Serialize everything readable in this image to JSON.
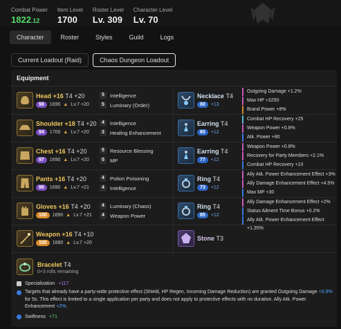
{
  "header": {
    "combat_power_label": "Combat Power",
    "combat_power_value": "1822",
    "combat_power_decimal": ".12",
    "item_level_label": "Item Level",
    "item_level_value": "1700",
    "roster_level_label": "Roster Level",
    "roster_level_value": "Lv. 309",
    "character_level_label": "Character Level",
    "character_level_value": "Lv. 70"
  },
  "tabs": [
    "Character",
    "Roster",
    "Styles",
    "Guild",
    "Logs"
  ],
  "loadouts": [
    "Current Loadout (Raid)",
    "Chaos Dungeon Loadout"
  ],
  "equipment": {
    "title": "Equipment",
    "left": [
      {
        "name": "Head +16",
        "tier": "T4 +20",
        "quality": "98",
        "ilvl": "1690",
        "transcend": "Lv.7 +20",
        "engravings": [
          {
            "n": "5",
            "label": "Intelligence"
          },
          {
            "n": "5",
            "label": "Luminary (Order)"
          }
        ]
      },
      {
        "name": "Shoulder +18",
        "tier": "T4 +20",
        "quality": "94",
        "ilvl": "1700",
        "transcend": "Lv.7 +20",
        "engravings": [
          {
            "n": "4",
            "label": "Intelligence"
          },
          {
            "n": "3",
            "label": "Healing Enhancement"
          }
        ]
      },
      {
        "name": "Chest +16",
        "tier": "T4 +20",
        "quality": "97",
        "ilvl": "1690",
        "transcend": "Lv.7 +20",
        "engravings": [
          {
            "n": "5",
            "label": "Resource Blessing"
          },
          {
            "n": "5",
            "label": "MP"
          }
        ]
      },
      {
        "name": "Pants +16",
        "tier": "T4 +20",
        "quality": "96",
        "ilvl": "1690",
        "transcend": "Lv.7 +21",
        "engravings": [
          {
            "n": "4",
            "label": "Potion Poisoning"
          },
          {
            "n": "4",
            "label": "Intelligence"
          }
        ]
      },
      {
        "name": "Gloves +16",
        "tier": "T4 +20",
        "quality": "100",
        "ilvl": "1690",
        "transcend": "Lv.7 +21",
        "engravings": [
          {
            "n": "4",
            "label": "Luminary (Chaos)"
          },
          {
            "n": "4",
            "label": "Weapon Power"
          }
        ]
      },
      {
        "name": "Weapon +16",
        "tier": "T4 +10",
        "quality": "100",
        "ilvl": "1680",
        "transcend": "Lv.7 +20",
        "engravings": []
      }
    ],
    "right": [
      {
        "name": "Necklace",
        "tier": "T4",
        "quality": "80",
        "bonus": "+13",
        "effects": [
          "Outgoing Damage +1.2%",
          "Max HP +3250",
          "Brand Power +8%"
        ]
      },
      {
        "name": "Earring",
        "tier": "T4",
        "quality": "80",
        "bonus": "+12",
        "effects": [
          "Combat HP Recovery +25",
          "Weapon Power +0.8%",
          "Atk. Power +80"
        ]
      },
      {
        "name": "Earring",
        "tier": "T4",
        "quality": "77",
        "bonus": "+12",
        "effects": [
          "Weapon Power +0.8%",
          "Recovery for Party Members +2.1%",
          "Combat HP Recovery +10"
        ]
      },
      {
        "name": "Ring",
        "tier": "T4",
        "quality": "73",
        "bonus": "+12",
        "effects": [
          "Ally Atk. Power Enhancement Effect +3%",
          "Ally Damage Enhancement Effect +4.5%",
          "Max MP +30"
        ]
      },
      {
        "name": "Ring",
        "tier": "T4",
        "quality": "85",
        "bonus": "+12",
        "effects": [
          "Ally Damage Enhancement Effect +2%",
          "Status Ailment Time Bonus +0.2%",
          "Ally Atk. Power Enhancement Effect +1.35%"
        ]
      },
      {
        "name": "Stone",
        "tier": "T3"
      }
    ]
  },
  "bracelet": {
    "name": "Bracelet",
    "tier": "T4",
    "rolls": "0+3 rolls remaining",
    "specialization_label": "Specialization",
    "specialization_value": "+117",
    "desc_1": "Targets that already have a party-wide protective effect (Shield, HP Regen, Incoming Damage Reduction) are granted Outgoing Damage",
    "desc_hl_1": "+0.9%",
    "desc_2": " for 5s. This effect is limited to a single application per party and does not apply to protective effects with no duration. Ally Atk. Power Enhancement",
    "desc_hl_2": "+2%",
    "desc_3": ".",
    "swiftness_label": "Swiftness",
    "swiftness_value": "+71"
  },
  "colors": {
    "accent_green": "#58d86a",
    "gold": "#f0c75e",
    "purple": "#7b4fc4",
    "orange": "#d98a2c",
    "blue": "#2e67c6"
  }
}
